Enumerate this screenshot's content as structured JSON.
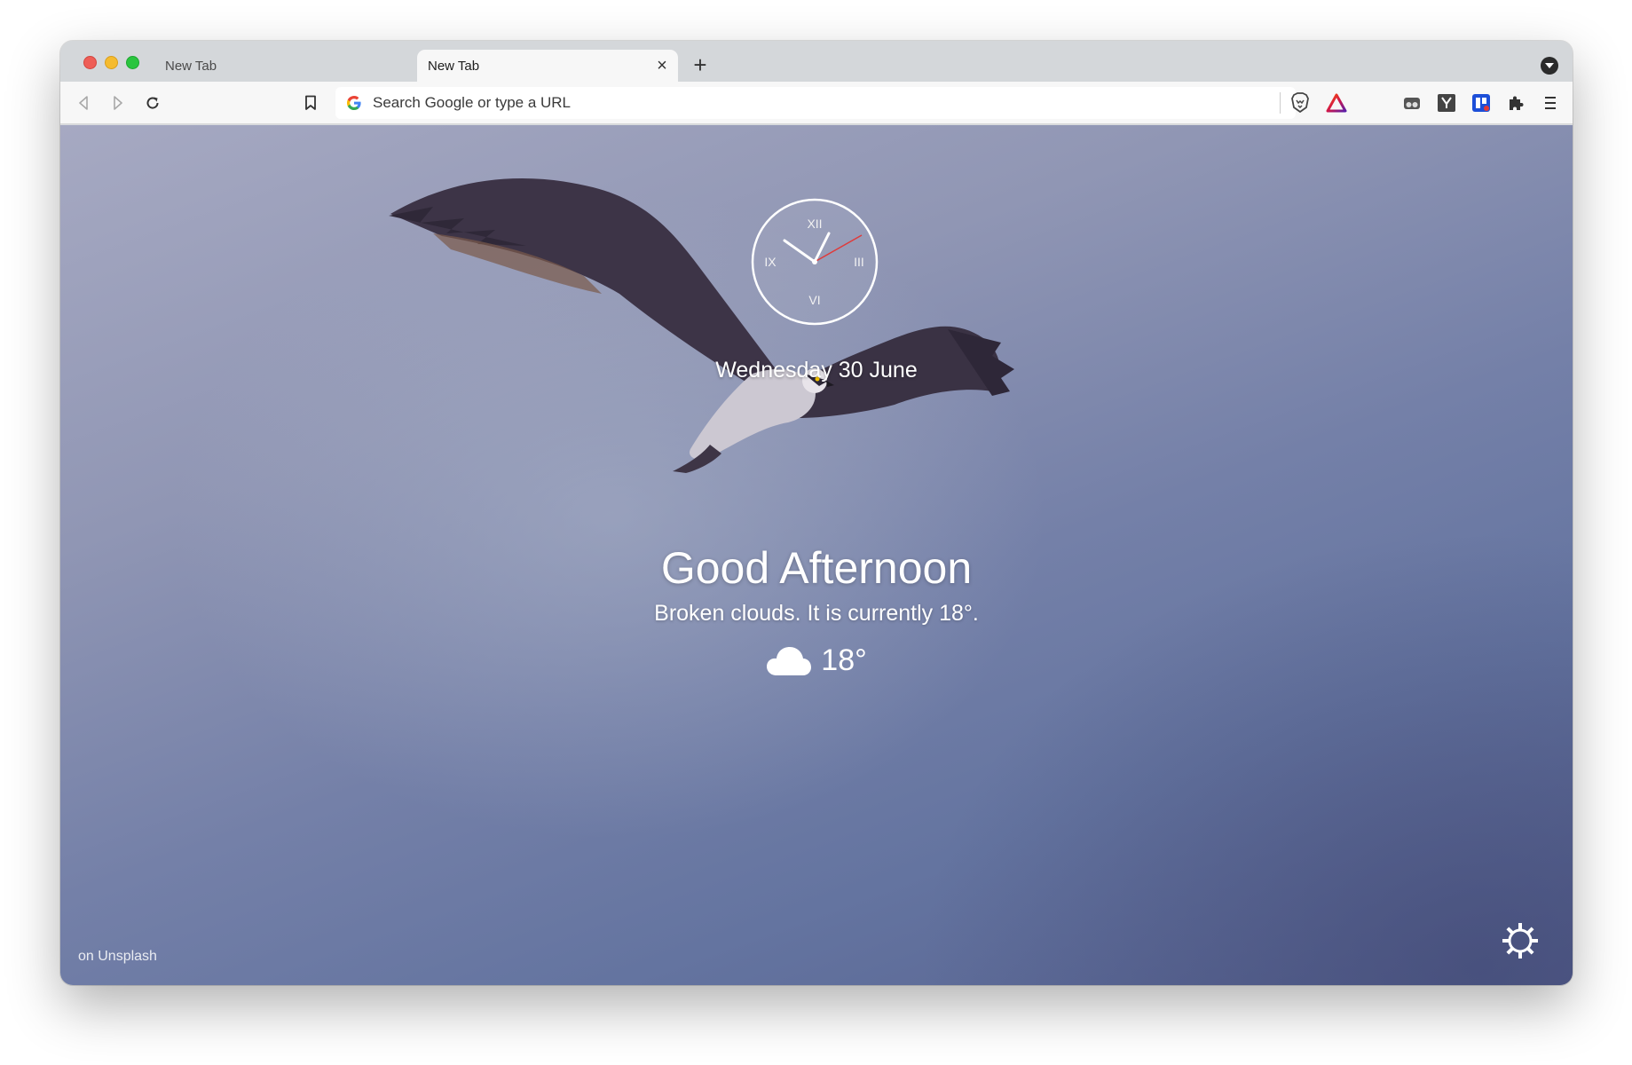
{
  "browser": {
    "tabs": [
      {
        "label": "New Tab",
        "active": false
      },
      {
        "label": "New Tab",
        "active": true
      }
    ],
    "tab_close_icon": "×",
    "new_tab_icon": "+",
    "omnibox": {
      "placeholder": "Search Google or type a URL",
      "value": ""
    }
  },
  "page": {
    "clock": {
      "numerals": {
        "twelve": "XII",
        "three": "III",
        "six": "VI",
        "nine": "IX"
      },
      "hour_hand_color": "#ffffff",
      "second_hand_color": "#e03a3a"
    },
    "date": "Wednesday 30 June",
    "greeting": "Good Afternoon",
    "weather_description": "Broken clouds. It is currently 18°.",
    "temperature": "18°",
    "weather_icon": "cloud-icon",
    "photo_credit": "on Unsplash",
    "settings_icon": "gear-icon"
  },
  "colors": {
    "accent_brave_rewards": "#e23c3c",
    "background_top": "#a6a9c2",
    "background_bottom": "#55608e"
  }
}
